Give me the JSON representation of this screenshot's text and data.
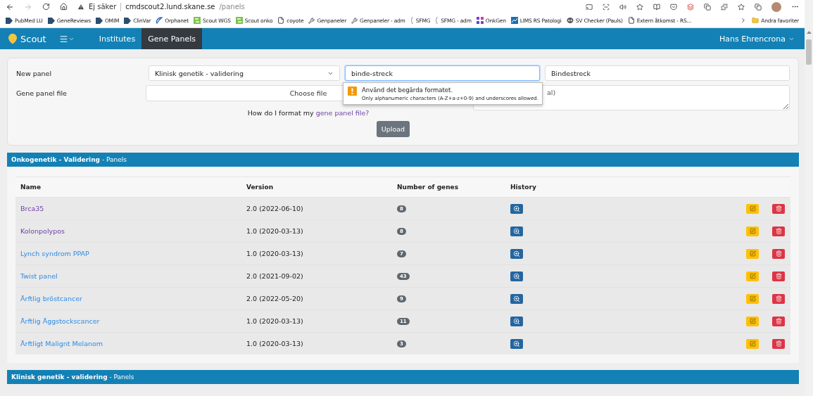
{
  "browser": {
    "security": "Ej säker",
    "url_host": "cmdscout2.lund.skane.se",
    "url_path": "/panels",
    "bookmarks": [
      {
        "label": "PubMed LU",
        "kind": "tag"
      },
      {
        "label": "GeneReviews",
        "kind": "tag"
      },
      {
        "label": "OMIM",
        "kind": "tag"
      },
      {
        "label": "ClinVar",
        "kind": "tag"
      },
      {
        "label": "Orphanet",
        "kind": "swirl"
      },
      {
        "label": "Scout WGS",
        "kind": "sc"
      },
      {
        "label": "Scout onko",
        "kind": "sc"
      },
      {
        "label": "coyote",
        "kind": "page"
      },
      {
        "label": "Genpaneler",
        "kind": "tool"
      },
      {
        "label": "Genpaneler - adm",
        "kind": "tool"
      },
      {
        "label": "SFMG",
        "kind": "brace"
      },
      {
        "label": "SFMG - adm",
        "kind": "brace"
      },
      {
        "label": "OnkGen",
        "kind": "grid"
      },
      {
        "label": "LIMS RS Patologi",
        "kind": "chart"
      },
      {
        "label": "SV Checker (Pauls)",
        "kind": "alien"
      },
      {
        "label": "Extern åtkomst - RS...",
        "kind": "page"
      }
    ],
    "more_favorites": "Andra favoriter"
  },
  "navbar": {
    "brand": "Scout",
    "links": [
      {
        "label": "Institutes",
        "selected": false
      },
      {
        "label": "Gene Panels",
        "selected": true
      }
    ],
    "user": "Hans Ehrencrona"
  },
  "form": {
    "new_panel_label": "New panel",
    "institute_select": "Klinisk genetik - validering",
    "panel_id_value": "binde-streck",
    "display_name_value": "Bindestreck",
    "file_label": "Gene panel file",
    "file_button": "Choose file",
    "help_text": "How do I format my",
    "help_link": "gene panel file?",
    "description_placeholder": "al)",
    "upload": "Upload",
    "validation": {
      "title": "Använd det begärda formatet.",
      "message": "Only alphanumeric characters (A-Z+a-z+0-9) and underscores allowed."
    }
  },
  "panels": [
    {
      "title": "**Onkogenetik - Validering** - Panels",
      "columns": [
        "Name",
        "Version",
        "Number of genes",
        "History"
      ],
      "rows": [
        {
          "name": "Brca35",
          "visited": true,
          "version": "2.0 (2022-06-10)",
          "genes": "8"
        },
        {
          "name": "Kolonpolypos",
          "visited": true,
          "version": "1.0 (2020-03-13)",
          "genes": "8"
        },
        {
          "name": "Lynch syndrom PPAP",
          "visited": false,
          "version": "1.0 (2020-03-13)",
          "genes": "7"
        },
        {
          "name": "Twist panel",
          "visited": false,
          "version": "2.0 (2021-09-02)",
          "genes": "43"
        },
        {
          "name": "Ärftlig bröstcancer",
          "visited": false,
          "version": "2.0 (2022-05-20)",
          "genes": "9"
        },
        {
          "name": "Ärftlig Äggstockscancer",
          "visited": false,
          "version": "1.0 (2020-03-13)",
          "genes": "11"
        },
        {
          "name": "Ärftligt Malignt Melanom",
          "visited": false,
          "version": "1.0 (2020-03-13)",
          "genes": "3"
        }
      ]
    },
    {
      "title": "**Klinisk genetik - validering** - Panels"
    }
  ]
}
